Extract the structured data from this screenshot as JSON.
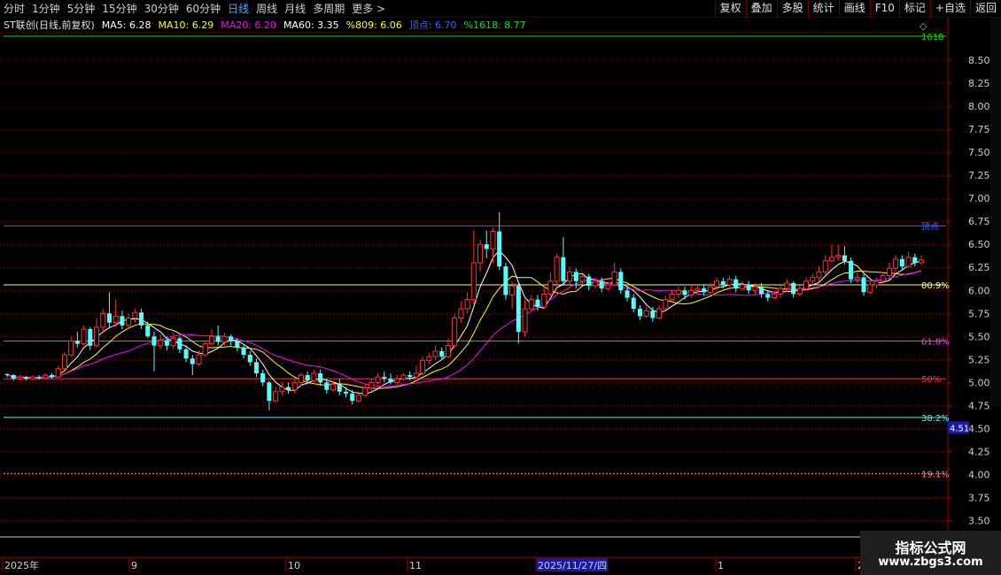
{
  "periods": [
    {
      "label": "分时",
      "active": false
    },
    {
      "label": "1分钟",
      "active": false
    },
    {
      "label": "5分钟",
      "active": false
    },
    {
      "label": "15分钟",
      "active": false
    },
    {
      "label": "30分钟",
      "active": false
    },
    {
      "label": "60分钟",
      "active": false
    },
    {
      "label": "日线",
      "active": true
    },
    {
      "label": "周线",
      "active": false
    },
    {
      "label": "月线",
      "active": false
    },
    {
      "label": "多周期",
      "active": false
    },
    {
      "label": "更多 >",
      "active": false
    }
  ],
  "tools": [
    "复权",
    "叠加",
    "多股",
    "统计",
    "画线",
    "F10",
    "标记",
    "+自选",
    "返回"
  ],
  "stock_title": "ST联创(日线,前复权)",
  "indicators": [
    {
      "text": "MA5: 6.28",
      "color": "#ffffff"
    },
    {
      "text": "MA10: 6.29",
      "color": "#ffff00"
    },
    {
      "text": "MA20: 6.20",
      "color": "#ff00ff"
    },
    {
      "text": "MA60: 3.35",
      "color": "#ffffff"
    },
    {
      "text": "%809: 6.06",
      "color": "#ffff00"
    },
    {
      "text": "顶点: 6.70",
      "color": "#3d5cff"
    },
    {
      "text": "%1618: 8.77",
      "color": "#00e000"
    }
  ],
  "colors": {
    "up": "#ff3232",
    "down": "#54ffff",
    "ma5": "#ffffff",
    "ma10": "#ffff00",
    "ma20": "#ff00ff",
    "grid": "#8a0000"
  },
  "chart_data": {
    "type": "candlestick",
    "y_axis": {
      "min": 3.5,
      "max": 8.5,
      "ticks": [
        "8.50",
        "8.25",
        "8.00",
        "7.75",
        "7.50",
        "7.25",
        "7.00",
        "6.75",
        "6.50",
        "6.25",
        "6.00",
        "5.75",
        "5.50",
        "5.25",
        "5.00",
        "4.75",
        "4.50",
        "4.25",
        "4.00",
        "3.75",
        "3.50"
      ],
      "tick_values": [
        8.5,
        8.25,
        8.0,
        7.75,
        7.5,
        7.25,
        7.0,
        6.75,
        6.5,
        6.25,
        6.0,
        5.75,
        5.5,
        5.25,
        5.0,
        4.75,
        4.5,
        4.25,
        4.0,
        3.75,
        3.5
      ]
    },
    "x_labels": [
      "2025年",
      "9",
      "10",
      "11",
      "2025/11/27/四",
      "1",
      "2"
    ],
    "levels": [
      {
        "label": "1618",
        "value": 8.77,
        "color": "#00e000"
      },
      {
        "label": "顶点",
        "value": 6.7,
        "color": "#3d5cff"
      },
      {
        "label": "80.9%",
        "value": 6.06,
        "color": "#ffff66"
      },
      {
        "label": "61.8%",
        "value": 5.45,
        "color": "#ff33ff"
      },
      {
        "label": "50%",
        "value": 5.04,
        "color": "#ff3333"
      },
      {
        "label": "38.2%",
        "value": 4.62,
        "color": "#33ffff"
      },
      {
        "label": "19.1%",
        "value": 4.01,
        "color": "#ff8888"
      }
    ],
    "axis_marker": "4.51",
    "candles": [
      [
        5.09,
        5.08,
        5.1,
        5.06
      ],
      [
        5.08,
        5.04,
        5.09,
        5.02
      ],
      [
        5.04,
        5.06,
        5.08,
        5.02
      ],
      [
        5.06,
        5.04,
        5.07,
        5.02
      ],
      [
        5.04,
        5.06,
        5.08,
        5.03
      ],
      [
        5.06,
        5.05,
        5.08,
        5.03
      ],
      [
        5.05,
        5.08,
        5.1,
        5.04
      ],
      [
        5.08,
        5.06,
        5.1,
        5.04
      ],
      [
        5.06,
        5.15,
        5.18,
        5.05
      ],
      [
        5.15,
        5.3,
        5.33,
        5.13
      ],
      [
        5.3,
        5.45,
        5.5,
        5.28
      ],
      [
        5.45,
        5.42,
        5.55,
        5.38
      ],
      [
        5.42,
        5.58,
        5.62,
        5.4
      ],
      [
        5.58,
        5.4,
        5.6,
        5.35
      ],
      [
        5.4,
        5.6,
        5.7,
        5.38
      ],
      [
        5.6,
        5.75,
        5.8,
        5.55
      ],
      [
        5.75,
        5.65,
        5.98,
        5.6
      ],
      [
        5.65,
        5.72,
        5.9,
        5.6
      ],
      [
        5.72,
        5.62,
        5.78,
        5.58
      ],
      [
        5.62,
        5.7,
        5.75,
        5.58
      ],
      [
        5.7,
        5.76,
        5.8,
        5.65
      ],
      [
        5.76,
        5.62,
        5.8,
        5.58
      ],
      [
        5.62,
        5.5,
        5.66,
        5.48
      ],
      [
        5.5,
        5.4,
        5.55,
        5.12
      ],
      [
        5.4,
        5.46,
        5.52,
        5.36
      ],
      [
        5.46,
        5.4,
        5.5,
        5.35
      ],
      [
        5.4,
        5.48,
        5.55,
        5.36
      ],
      [
        5.48,
        5.36,
        5.5,
        5.32
      ],
      [
        5.36,
        5.26,
        5.4,
        5.22
      ],
      [
        5.26,
        5.2,
        5.3,
        5.08
      ],
      [
        5.2,
        5.3,
        5.35,
        5.18
      ],
      [
        5.3,
        5.42,
        5.45,
        5.28
      ],
      [
        5.42,
        5.5,
        5.58,
        5.4
      ],
      [
        5.5,
        5.44,
        5.62,
        5.4
      ],
      [
        5.44,
        5.5,
        5.54,
        5.4
      ],
      [
        5.5,
        5.45,
        5.52,
        5.4
      ],
      [
        5.45,
        5.38,
        5.48,
        5.34
      ],
      [
        5.38,
        5.3,
        5.4,
        5.26
      ],
      [
        5.3,
        5.22,
        5.34,
        5.18
      ],
      [
        5.22,
        5.1,
        5.26,
        5.06
      ],
      [
        5.1,
        5.0,
        5.14,
        4.96
      ],
      [
        5.0,
        4.8,
        5.02,
        4.7
      ],
      [
        4.8,
        4.9,
        4.95,
        4.78
      ],
      [
        4.9,
        4.95,
        5.0,
        4.86
      ],
      [
        4.95,
        4.92,
        5.0,
        4.88
      ],
      [
        4.92,
        5.0,
        5.04,
        4.88
      ],
      [
        5.0,
        5.08,
        5.1,
        4.96
      ],
      [
        5.08,
        5.02,
        5.12,
        4.98
      ],
      [
        5.02,
        5.1,
        5.14,
        5.0
      ],
      [
        5.1,
        5.0,
        5.14,
        4.96
      ],
      [
        5.0,
        4.92,
        5.04,
        4.88
      ],
      [
        4.92,
        4.98,
        5.02,
        4.9
      ],
      [
        4.98,
        4.9,
        5.04,
        4.86
      ],
      [
        4.9,
        4.88,
        4.95,
        4.84
      ],
      [
        4.88,
        4.8,
        4.92,
        4.76
      ],
      [
        4.8,
        4.86,
        4.9,
        4.78
      ],
      [
        4.86,
        4.94,
        4.98,
        4.84
      ],
      [
        4.94,
        5.0,
        5.04,
        4.9
      ],
      [
        5.0,
        5.06,
        5.1,
        4.98
      ],
      [
        5.06,
        5.04,
        5.12,
        5.0
      ],
      [
        5.04,
        5.0,
        5.1,
        4.98
      ],
      [
        5.0,
        5.04,
        5.08,
        4.98
      ],
      [
        5.04,
        5.08,
        5.1,
        5.02
      ],
      [
        5.08,
        5.06,
        5.12,
        5.02
      ],
      [
        5.06,
        5.1,
        5.18,
        5.04
      ],
      [
        5.1,
        5.24,
        5.28,
        5.08
      ],
      [
        5.24,
        5.28,
        5.32,
        5.2
      ],
      [
        5.28,
        5.34,
        5.4,
        5.24
      ],
      [
        5.34,
        5.28,
        5.38,
        5.24
      ],
      [
        5.28,
        5.4,
        5.48,
        5.26
      ],
      [
        5.4,
        5.7,
        5.75,
        5.38
      ],
      [
        5.7,
        5.8,
        5.88,
        5.65
      ],
      [
        5.8,
        5.9,
        5.98,
        5.75
      ],
      [
        5.9,
        6.3,
        6.65,
        5.85
      ],
      [
        6.3,
        6.5,
        6.55,
        6.2
      ],
      [
        6.5,
        6.45,
        6.65,
        6.35
      ],
      [
        6.45,
        6.64,
        6.68,
        6.3
      ],
      [
        6.64,
        6.26,
        6.85,
        6.22
      ],
      [
        6.26,
        5.95,
        6.3,
        5.9
      ],
      [
        5.95,
        6.05,
        6.1,
        5.8
      ],
      [
        6.05,
        5.55,
        6.1,
        5.42
      ],
      [
        5.55,
        5.8,
        5.9,
        5.5
      ],
      [
        5.8,
        5.9,
        5.95,
        5.78
      ],
      [
        5.9,
        5.82,
        5.95,
        5.78
      ],
      [
        5.82,
        5.96,
        6.02,
        5.8
      ],
      [
        5.96,
        6.1,
        6.2,
        5.94
      ],
      [
        6.1,
        6.36,
        6.4,
        6.05
      ],
      [
        6.36,
        6.1,
        6.58,
        6.05
      ],
      [
        6.1,
        6.2,
        6.26,
        6.06
      ],
      [
        6.2,
        6.1,
        6.24,
        6.02
      ],
      [
        6.1,
        6.15,
        6.18,
        6.06
      ],
      [
        6.15,
        6.05,
        6.18,
        6.0
      ],
      [
        6.05,
        6.1,
        6.14,
        6.02
      ],
      [
        6.1,
        6.02,
        6.14,
        5.98
      ],
      [
        6.02,
        6.06,
        6.1,
        6.0
      ],
      [
        6.06,
        6.2,
        6.3,
        6.04
      ],
      [
        6.2,
        6.0,
        6.24,
        5.96
      ],
      [
        6.0,
        5.92,
        6.04,
        5.88
      ],
      [
        5.92,
        5.8,
        5.96,
        5.76
      ],
      [
        5.8,
        5.72,
        5.84,
        5.68
      ],
      [
        5.72,
        5.78,
        5.82,
        5.7
      ],
      [
        5.78,
        5.7,
        5.82,
        5.66
      ],
      [
        5.7,
        5.8,
        5.84,
        5.68
      ],
      [
        5.8,
        5.9,
        5.94,
        5.78
      ],
      [
        5.9,
        5.96,
        6.0,
        5.88
      ],
      [
        5.96,
        6.0,
        6.04,
        5.92
      ],
      [
        6.0,
        5.95,
        6.04,
        5.9
      ],
      [
        5.95,
        6.0,
        6.06,
        5.92
      ],
      [
        6.0,
        6.02,
        6.06,
        5.96
      ],
      [
        6.02,
        5.98,
        6.06,
        5.94
      ],
      [
        5.98,
        6.04,
        6.08,
        5.96
      ],
      [
        6.04,
        6.1,
        6.14,
        6.0
      ],
      [
        6.1,
        6.06,
        6.14,
        6.02
      ],
      [
        6.06,
        6.12,
        6.16,
        6.04
      ],
      [
        6.12,
        6.02,
        6.16,
        5.98
      ],
      [
        6.02,
        6.06,
        6.1,
        6.0
      ],
      [
        6.06,
        6.0,
        6.1,
        5.96
      ],
      [
        6.0,
        6.04,
        6.08,
        5.96
      ],
      [
        6.04,
        5.96,
        6.08,
        5.92
      ],
      [
        5.96,
        5.92,
        6.0,
        5.88
      ],
      [
        5.92,
        5.96,
        6.0,
        5.9
      ],
      [
        5.96,
        6.02,
        6.06,
        5.92
      ],
      [
        6.02,
        6.08,
        6.12,
        5.98
      ],
      [
        6.08,
        5.96,
        6.1,
        5.92
      ],
      [
        5.96,
        6.02,
        6.06,
        5.94
      ],
      [
        6.02,
        6.1,
        6.14,
        6.0
      ],
      [
        6.1,
        6.14,
        6.18,
        6.06
      ],
      [
        6.14,
        6.2,
        6.26,
        6.1
      ],
      [
        6.2,
        6.32,
        6.38,
        6.16
      ],
      [
        6.32,
        6.36,
        6.5,
        6.3
      ],
      [
        6.36,
        6.38,
        6.5,
        6.32
      ],
      [
        6.38,
        6.32,
        6.48,
        6.28
      ],
      [
        6.32,
        6.12,
        6.36,
        6.08
      ],
      [
        6.12,
        6.14,
        6.2,
        6.08
      ],
      [
        6.14,
        5.98,
        6.18,
        5.94
      ],
      [
        5.98,
        6.06,
        6.1,
        5.96
      ],
      [
        6.06,
        6.1,
        6.14,
        6.02
      ],
      [
        6.1,
        6.16,
        6.2,
        6.08
      ],
      [
        6.16,
        6.24,
        6.3,
        6.12
      ],
      [
        6.24,
        6.34,
        6.38,
        6.2
      ],
      [
        6.34,
        6.26,
        6.38,
        6.22
      ],
      [
        6.26,
        6.36,
        6.42,
        6.24
      ],
      [
        6.36,
        6.3,
        6.4,
        6.26
      ],
      [
        6.3,
        6.33,
        6.38,
        6.28
      ]
    ]
  },
  "watermark": {
    "line1": "指标公式网",
    "line2": "www.zbgs3.com"
  }
}
